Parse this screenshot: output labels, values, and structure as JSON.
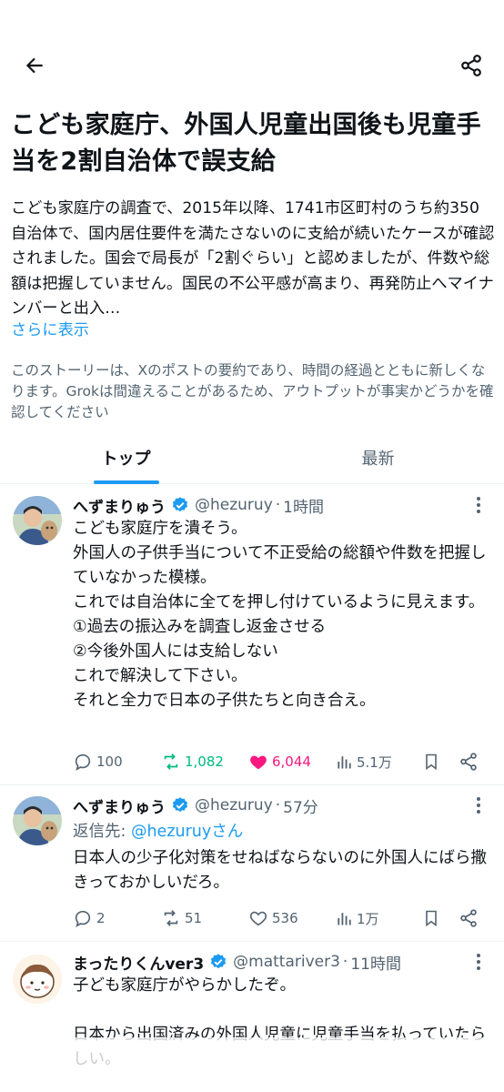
{
  "header": {
    "back_icon": "arrow-left-icon",
    "share_icon": "share-icon"
  },
  "headline": "こども家庭庁、外国人児童出国後も児童手当を2割自治体で誤支給",
  "summary": "こども家庭庁の調査で、2015年以降、1741市区町村のうち約350自治体で、国内居住要件を満たさないのに支給が続いたケースが確認されました。国会で局長が「2割ぐらい」と認めましたが、件数や総額は把握していません。国民の不公平感が高まり、再発防止へマイナンバーと出入…",
  "show_more": "さらに表示",
  "disclaimer": "このストーリーは、Xのポストの要約であり、時間の経過とともに新しくなります。Grokは間違えることがあるため、アウトプットが事実かどうかを確認してください",
  "tabs": {
    "top": "トップ",
    "latest": "最新"
  },
  "posts": [
    {
      "name": "へずまりゅう",
      "handle": "@hezuruy",
      "dot": "·",
      "time": "1時間",
      "text": "こども家庭庁を潰そう。\n外国人の子供手当について不正受給の総額や件数を把握していなかった模様。\nこれでは自治体に全てを押し付けているように見えます。\n①過去の振込みを調査し返金させる\n②今後外国人には支給しない\nこれで解決して下さい。\nそれと全力で日本の子供たちと向き合え。",
      "replies": "100",
      "reposts": "1,082",
      "likes": "6,044",
      "views": "5.1万"
    },
    {
      "name": "へずまりゅう",
      "handle": "@hezuruy",
      "dot": "·",
      "time": "57分",
      "reply_prefix": "返信先: ",
      "reply_target": "@hezuruyさん",
      "text": "日本人の少子化対策をせねばならないのに外国人にばら撒きっておかしいだろ。",
      "replies": "2",
      "reposts": "51",
      "likes": "536",
      "views": "1万"
    },
    {
      "name": "まったりくんver3",
      "handle": "@mattariver3",
      "dot": "·",
      "time": "11時間",
      "text": "子ども家庭庁がやらかしたぞ。\n\n日本から出国済みの外国人児童に児童手当を払っていたらしい。"
    }
  ],
  "colors": {
    "accent": "#1d9bf0",
    "secondary_text": "#536471",
    "repost_active": "#00ba7c",
    "like_active": "#f91880",
    "verified": "#1d9bf0"
  }
}
